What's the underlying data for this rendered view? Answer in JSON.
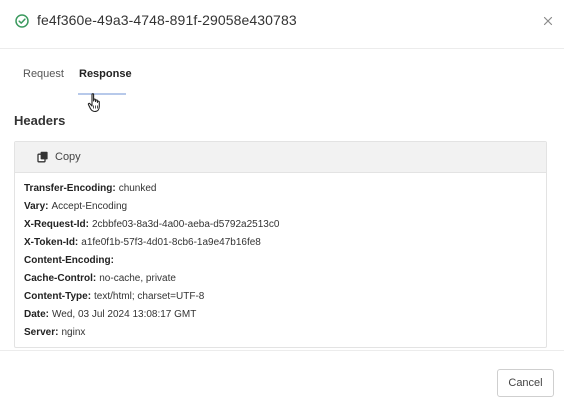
{
  "modal": {
    "title": "fe4f360e-49a3-4748-891f-29058e430783",
    "status": "success",
    "status_color": "#3c9a5f"
  },
  "tabs": [
    {
      "label": "Request",
      "active": false
    },
    {
      "label": "Response",
      "active": true
    }
  ],
  "section": {
    "title": "Headers"
  },
  "toolbar": {
    "copy_label": "Copy"
  },
  "headers": [
    {
      "key": "Transfer-Encoding:",
      "value": "chunked"
    },
    {
      "key": "Vary:",
      "value": "Accept-Encoding"
    },
    {
      "key": "X-Request-Id:",
      "value": "2cbbfe03-8a3d-4a00-aeba-d5792a2513c0"
    },
    {
      "key": "X-Token-Id:",
      "value": "a1fe0f1b-57f3-4d01-8cb6-1a9e47b16fe8"
    },
    {
      "key": "Content-Encoding:",
      "value": ""
    },
    {
      "key": "Cache-Control:",
      "value": "no-cache, private"
    },
    {
      "key": "Content-Type:",
      "value": "text/html; charset=UTF-8"
    },
    {
      "key": "Date:",
      "value": "Wed, 03 Jul 2024 13:08:17 GMT"
    },
    {
      "key": "Server:",
      "value": "nginx"
    }
  ],
  "footer": {
    "cancel_label": "Cancel"
  },
  "icons": {
    "status": "check-circle-icon",
    "close": "close-icon",
    "copy": "copy-icon",
    "cursor": "hand-pointer-icon"
  }
}
